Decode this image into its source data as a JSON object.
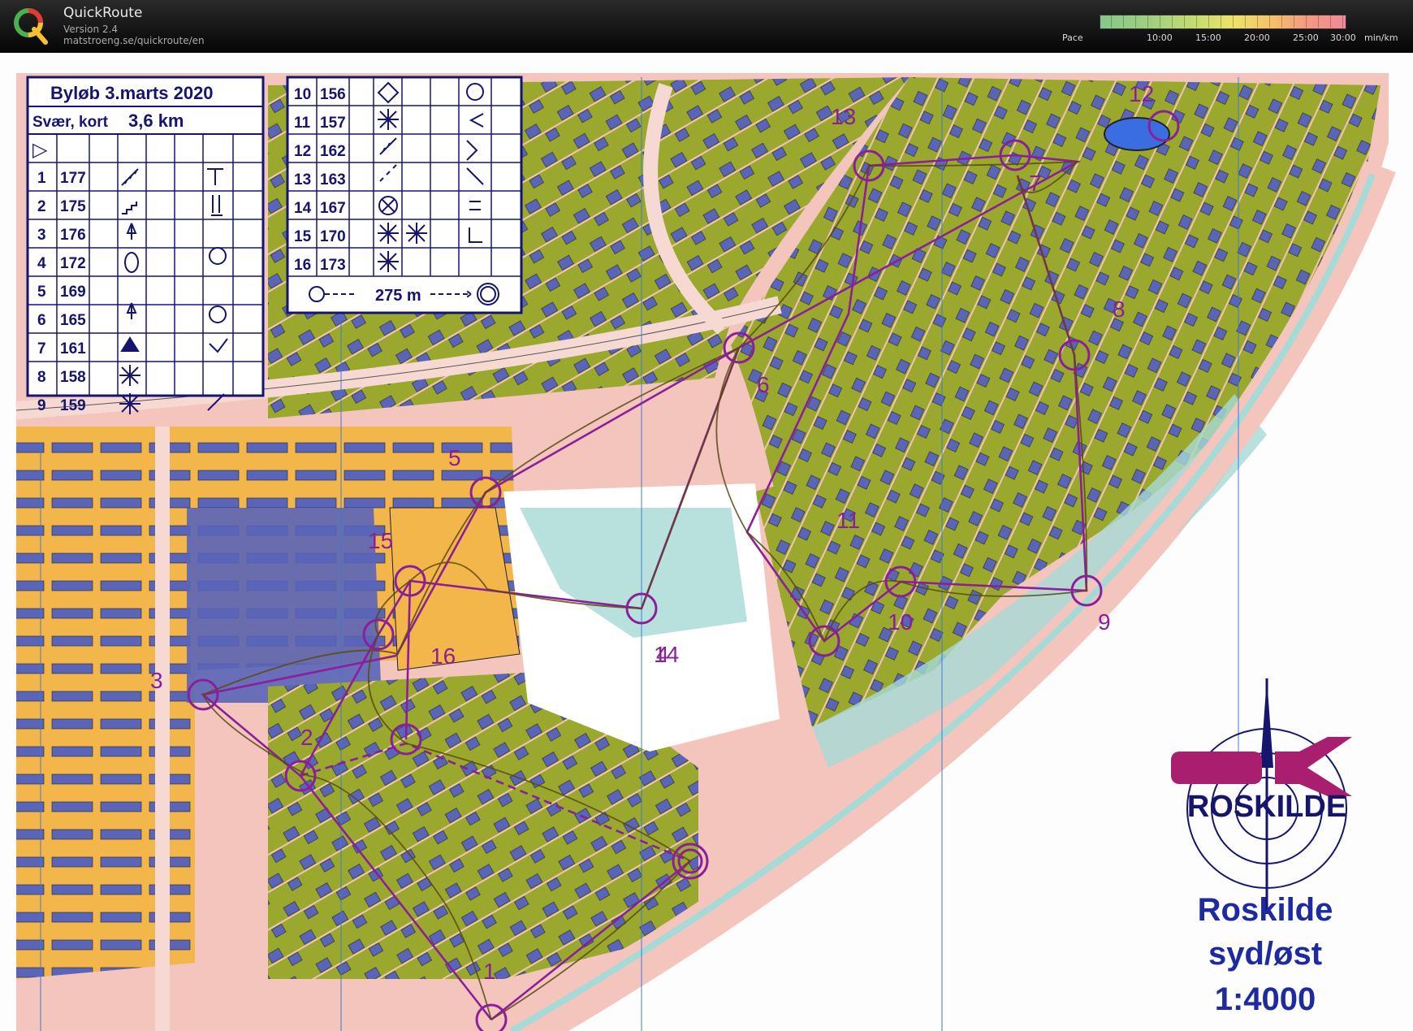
{
  "app": {
    "title": "QuickRoute",
    "version": "Version 2.4",
    "url": "matstroeng.se/quickroute/en"
  },
  "pace_legend": {
    "label": "Pace",
    "ticks": [
      "10:00",
      "15:00",
      "20:00",
      "25:00",
      "30:00"
    ],
    "unit": "min/km"
  },
  "course_card": {
    "title": "Byløb 3.marts  2020",
    "class": "Svær, kort",
    "length": "3,6 km",
    "start_symbol": "▷",
    "controls_left": [
      {
        "num": "1",
        "code": "177"
      },
      {
        "num": "2",
        "code": "175"
      },
      {
        "num": "3",
        "code": "176"
      },
      {
        "num": "4",
        "code": "172"
      },
      {
        "num": "5",
        "code": "169"
      },
      {
        "num": "6",
        "code": "165"
      },
      {
        "num": "7",
        "code": "161"
      },
      {
        "num": "8",
        "code": "158"
      },
      {
        "num": "9",
        "code": "159"
      }
    ],
    "controls_right": [
      {
        "num": "10",
        "code": "156"
      },
      {
        "num": "11",
        "code": "157"
      },
      {
        "num": "12",
        "code": "162"
      },
      {
        "num": "13",
        "code": "163"
      },
      {
        "num": "14",
        "code": "167"
      },
      {
        "num": "15",
        "code": "170"
      },
      {
        "num": "16",
        "code": "173"
      }
    ],
    "finish_distance": "275 m"
  },
  "map": {
    "control_labels": [
      "1",
      "2",
      "3",
      "4",
      "5",
      "6",
      "7",
      "8",
      "9",
      "10",
      "11",
      "12",
      "13",
      "14",
      "15",
      "16"
    ],
    "club": "ROSKILDE",
    "map_name_line1": "Roskilde",
    "map_name_line2": "syd/øst",
    "scale": "1:4000",
    "colors": {
      "course": "#8b1f9a",
      "route": "#5b4a12",
      "building": "#5a64b8",
      "garden": "#9aa82e",
      "open": "#f2b64a",
      "water": "#a6dad6",
      "road": "#f4c8c0"
    }
  }
}
